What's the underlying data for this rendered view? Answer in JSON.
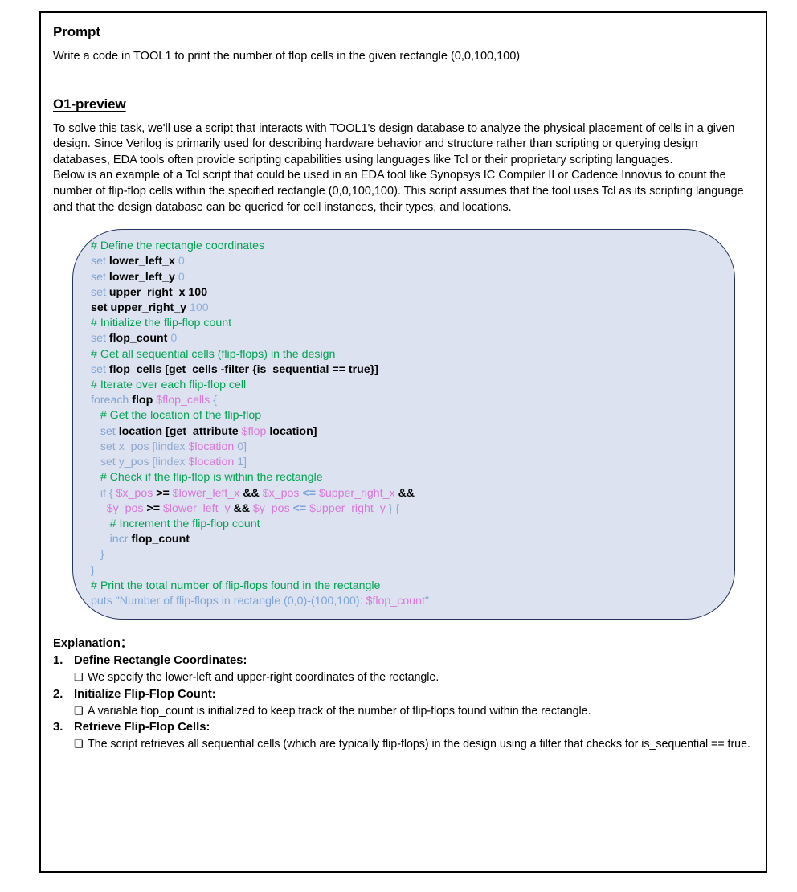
{
  "document": {
    "prompt": {
      "heading": "Prompt",
      "text": "Write a code in TOOL1 to print the number of flop cells in the given rectangle (0,0,100,100)"
    },
    "answer": {
      "heading": "O1-preview",
      "paragraphs": [
        "To solve this task, we'll use a script that interacts with TOOL1's design database to analyze the physical placement of cells in a given design. Since Verilog is primarily used for describing hardware behavior and structure rather than scripting or querying design databases, EDA tools often provide scripting capabilities using languages like Tcl or their proprietary scripting languages.",
        "Below is an example of a Tcl script that could be used in an EDA tool like Synopsys IC Compiler II or Cadence Innovus to count the number of flip-flop cells within the specified rectangle (0,0,100,100). This script assumes that the tool uses Tcl as its scripting language and that the design database can be queried for cell instances, their types, and locations."
      ]
    },
    "code_block": {
      "language": "Tcl",
      "background_color": "#dce2f0",
      "border_color": "#26335c",
      "lines": [
        {
          "tokens": [
            {
              "t": "# Define the rectangle coordinates",
              "c": "comment"
            }
          ]
        },
        {
          "tokens": [
            {
              "t": "set ",
              "c": "kw"
            },
            {
              "t": "lower_left_x ",
              "c": "plain"
            },
            {
              "t": "0",
              "c": "num"
            }
          ]
        },
        {
          "tokens": [
            {
              "t": "set ",
              "c": "kw"
            },
            {
              "t": "lower_left_y ",
              "c": "plain"
            },
            {
              "t": "0",
              "c": "num"
            }
          ]
        },
        {
          "tokens": [
            {
              "t": "set ",
              "c": "kw"
            },
            {
              "t": "upper_right_x 100",
              "c": "plain"
            }
          ]
        },
        {
          "tokens": [
            {
              "t": "set upper_right_y ",
              "c": "plain"
            },
            {
              "t": "100",
              "c": "num"
            }
          ]
        },
        {
          "tokens": [
            {
              "t": "# Initialize the flip-flop count",
              "c": "comment"
            }
          ]
        },
        {
          "tokens": [
            {
              "t": "set ",
              "c": "kw"
            },
            {
              "t": "flop_count ",
              "c": "plain"
            },
            {
              "t": "0",
              "c": "num"
            }
          ]
        },
        {
          "tokens": [
            {
              "t": "# Get all sequential cells (flip-flops) in the design",
              "c": "comment"
            }
          ]
        },
        {
          "tokens": [
            {
              "t": "set ",
              "c": "kw"
            },
            {
              "t": "flop_cells [get_cells -filter {is_sequential == true}]",
              "c": "plain"
            }
          ]
        },
        {
          "tokens": [
            {
              "t": "# Iterate over each flip-flop cell",
              "c": "comment"
            }
          ]
        },
        {
          "tokens": [
            {
              "t": "foreach ",
              "c": "kw"
            },
            {
              "t": "flop ",
              "c": "plain"
            },
            {
              "t": "$flop_cells ",
              "c": "var"
            },
            {
              "t": "{",
              "c": "brace"
            }
          ]
        },
        {
          "tokens": [
            {
              "t": "   # Get the location of the flip-flop",
              "c": "comment"
            }
          ]
        },
        {
          "tokens": [
            {
              "t": "   ",
              "c": "plain"
            },
            {
              "t": "set ",
              "c": "kw"
            },
            {
              "t": "location [get_attribute ",
              "c": "plain"
            },
            {
              "t": "$flop ",
              "c": "var"
            },
            {
              "t": "location]",
              "c": "plain"
            }
          ]
        },
        {
          "tokens": [
            {
              "t": "   set x_pos [lindex ",
              "c": "kw2"
            },
            {
              "t": "$location ",
              "c": "var"
            },
            {
              "t": "0]",
              "c": "kw2"
            }
          ]
        },
        {
          "tokens": [
            {
              "t": "   set y_pos [lindex ",
              "c": "kw2"
            },
            {
              "t": "$location ",
              "c": "var"
            },
            {
              "t": "1]",
              "c": "kw2"
            }
          ]
        },
        {
          "tokens": [
            {
              "t": "   # Check if the flip-flop is within the rectangle",
              "c": "comment"
            }
          ]
        },
        {
          "tokens": [
            {
              "t": "   if { ",
              "c": "kw2"
            },
            {
              "t": "$x_pos ",
              "c": "var"
            },
            {
              "t": ">= ",
              "c": "op"
            },
            {
              "t": "$lower_left_x ",
              "c": "var"
            },
            {
              "t": "&& ",
              "c": "op"
            },
            {
              "t": "$x_pos ",
              "c": "var"
            },
            {
              "t": "<= ",
              "c": "op2"
            },
            {
              "t": "$upper_right_x ",
              "c": "var"
            },
            {
              "t": "&&",
              "c": "op"
            }
          ]
        },
        {
          "tokens": [
            {
              "t": "     ",
              "c": "plain"
            },
            {
              "t": "$y_pos ",
              "c": "var"
            },
            {
              "t": ">= ",
              "c": "op"
            },
            {
              "t": "$lower_left_y ",
              "c": "var"
            },
            {
              "t": "&& ",
              "c": "op"
            },
            {
              "t": "$y_pos ",
              "c": "var"
            },
            {
              "t": "<= ",
              "c": "op2"
            },
            {
              "t": "$upper_right_y ",
              "c": "var"
            },
            {
              "t": "} {",
              "c": "kw2"
            }
          ]
        },
        {
          "tokens": [
            {
              "t": "      # Increment the flip-flop count",
              "c": "comment"
            }
          ]
        },
        {
          "tokens": [
            {
              "t": "      ",
              "c": "plain"
            },
            {
              "t": "incr ",
              "c": "kw"
            },
            {
              "t": "flop_count",
              "c": "plain"
            }
          ]
        },
        {
          "tokens": [
            {
              "t": "   }",
              "c": "brace"
            }
          ]
        },
        {
          "tokens": [
            {
              "t": "}",
              "c": "brace"
            }
          ]
        },
        {
          "tokens": [
            {
              "t": "# Print the total number of flip-flops found in the rectangle",
              "c": "comment"
            }
          ]
        },
        {
          "tokens": [
            {
              "t": "puts \"Number of flip-flops in rectangle (0,0)-(100,100): ",
              "c": "str"
            },
            {
              "t": "$flop_count",
              "c": "var"
            },
            {
              "t": "\"",
              "c": "str"
            }
          ]
        }
      ]
    },
    "explanation": {
      "title": "Explanation：",
      "bullet_marker": "❑",
      "steps": [
        {
          "number": "1.",
          "title": "Define Rectangle Coordinates:",
          "details": [
            "We specify the lower-left and upper-right coordinates of the rectangle."
          ]
        },
        {
          "number": "2.",
          "title": "Initialize Flip-Flop Count:",
          "details": [
            "A variable flop_count is initialized to keep track of the number of flip-flops found within the rectangle."
          ]
        },
        {
          "number": "3.",
          "title": "Retrieve Flip-Flop Cells:",
          "details": [
            "The script retrieves all sequential cells (which are typically flip-flops) in the design using a filter that checks for is_sequential == true."
          ]
        }
      ]
    }
  }
}
